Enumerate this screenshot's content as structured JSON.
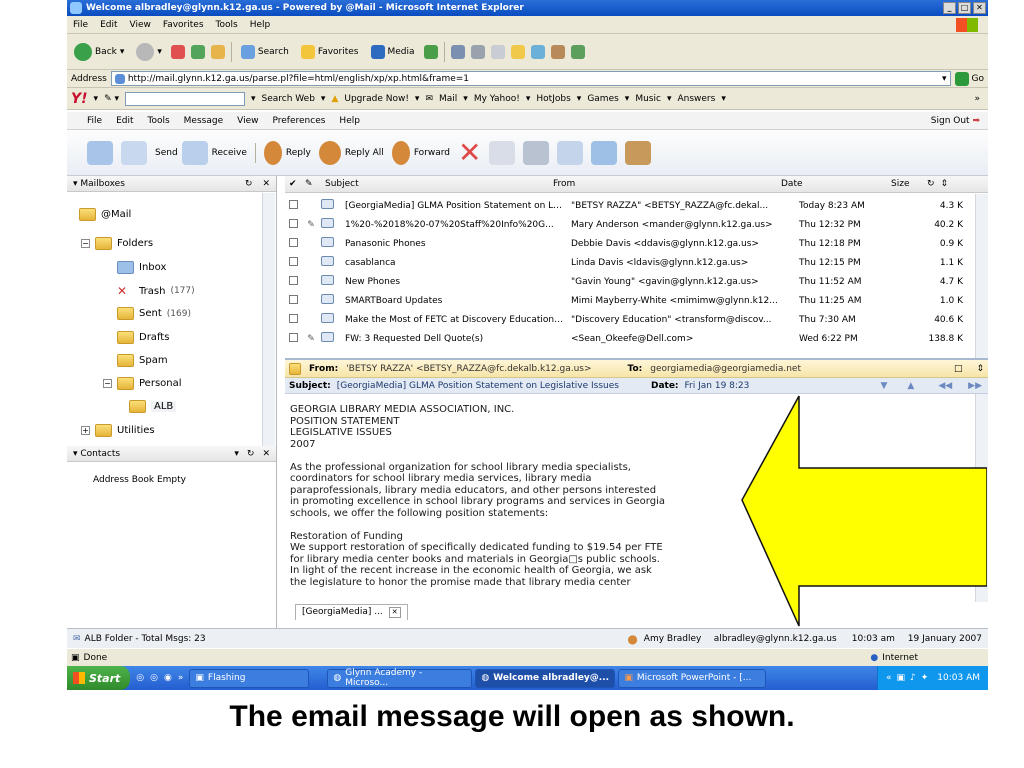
{
  "window": {
    "title": "Welcome albradley@glynn.k12.ga.us - Powered by @Mail - Microsoft Internet Explorer"
  },
  "ie_menu": [
    "File",
    "Edit",
    "View",
    "Favorites",
    "Tools",
    "Help"
  ],
  "ie_toolbar": {
    "back": "Back",
    "search": "Search",
    "favorites": "Favorites",
    "media": "Media"
  },
  "address": {
    "label": "Address",
    "url": "http://mail.glynn.k12.ga.us/parse.pl?file=html/english/xp/xp.html&frame=1",
    "go": "Go"
  },
  "yahoo_bar": {
    "search_web": "Search Web",
    "upgrade": "Upgrade Now!",
    "mail": "Mail",
    "my_yahoo": "My Yahoo!",
    "hotjobs": "HotJobs",
    "games": "Games",
    "music": "Music",
    "answers": "Answers"
  },
  "app_menu": [
    "File",
    "Edit",
    "Tools",
    "Message",
    "View",
    "Preferences",
    "Help"
  ],
  "sign_out": "Sign Out",
  "app_toolbar": {
    "send": "Send",
    "receive": "Receive",
    "reply": "Reply",
    "reply_all": "Reply All",
    "forward": "Forward"
  },
  "mailboxes": {
    "header": "Mailboxes",
    "root": "@Mail",
    "folders_label": "Folders",
    "inbox": "Inbox",
    "trash": "Trash",
    "trash_count": "(177)",
    "sent": "Sent",
    "sent_count": "(169)",
    "drafts": "Drafts",
    "spam": "Spam",
    "personal": "Personal",
    "alb": "ALB",
    "utilities": "Utilities"
  },
  "contacts": {
    "header": "Contacts",
    "empty": "Address Book Empty"
  },
  "message_list": {
    "columns": {
      "subject": "Subject",
      "from": "From",
      "date": "Date",
      "size": "Size"
    },
    "rows": [
      {
        "subject": "[GeorgiaMedia] GLMA Position Statement on Leg...",
        "from": "\"BETSY RAZZA\" <BETSY_RAZZA@fc.dekal...",
        "date": "Today 8:23 AM",
        "size": "4.3 K",
        "attach": ""
      },
      {
        "subject": "1%20-%2018%20-07%20Staff%20Info%20G...",
        "from": "Mary Anderson <mander@glynn.k12.ga.us>",
        "date": "Thu 12:32 PM",
        "size": "40.2 K",
        "attach": "✎"
      },
      {
        "subject": "Panasonic Phones",
        "from": "Debbie Davis <ddavis@glynn.k12.ga.us>",
        "date": "Thu 12:18 PM",
        "size": "0.9 K",
        "attach": ""
      },
      {
        "subject": "casablanca",
        "from": "Linda Davis <ldavis@glynn.k12.ga.us>",
        "date": "Thu 12:15 PM",
        "size": "1.1 K",
        "attach": ""
      },
      {
        "subject": "New Phones",
        "from": "\"Gavin Young\" <gavin@glynn.k12.ga.us>",
        "date": "Thu 11:52 AM",
        "size": "4.7 K",
        "attach": ""
      },
      {
        "subject": "SMARTBoard Updates",
        "from": "Mimi Mayberry-White <mimimw@glynn.k12...",
        "date": "Thu 11:25 AM",
        "size": "1.0 K",
        "attach": ""
      },
      {
        "subject": "Make the Most of FETC at Discovery Education ...",
        "from": "\"Discovery Education\" <transform@discov...",
        "date": "Thu 7:30 AM",
        "size": "40.6 K",
        "attach": ""
      },
      {
        "subject": "FW: 3 Requested Dell Quote(s)",
        "from": "<Sean_Okeefe@Dell.com>",
        "date": "Wed 6:22 PM",
        "size": "138.8 K",
        "attach": "✎"
      }
    ]
  },
  "preview": {
    "from_label": "From:",
    "from_value": "'BETSY RAZZA' <BETSY_RAZZA@fc.dekalb.k12.ga.us>",
    "to_label": "To:",
    "to_value": "georgiamedia@georgiamedia.net",
    "subject_label": "Subject:",
    "subject_value": "[GeorgiaMedia] GLMA Position Statement on Legislative Issues",
    "date_label": "Date:",
    "date_value": "Fri Jan 19 8:23",
    "body": "GEORGIA LIBRARY MEDIA ASSOCIATION, INC.\nPOSITION STATEMENT\nLEGISLATIVE ISSUES\n2007\n\nAs the professional organization for school library media specialists,\ncoordinators for school library media services, library media\nparaprofessionals, library media educators, and other persons interested\nin promoting excellence in school library programs and services in Georgia\nschools, we offer the following position statements:\n\nRestoration of Funding\nWe support restoration of specifically dedicated funding to $19.54 per FTE\nfor library media center books and materials in Georgia□s public schools.\nIn light of the recent increase in the economic health of Georgia, we ask\nthe legislature to honor the promise made that library media center",
    "tab": "[GeorgiaMedia] ..."
  },
  "status": {
    "folder": "ALB Folder - Total Msgs: 23",
    "user": "Amy Bradley",
    "email": "albradley@glynn.k12.ga.us",
    "time": "10:03 am",
    "date": "19 January 2007"
  },
  "ie_status": {
    "done": "Done",
    "zone": "Internet"
  },
  "taskbar": {
    "start": "Start",
    "flashing": "Flashing",
    "task1": "Glynn Academy - Microso...",
    "task2": "Welcome albradley@...",
    "task3": "Microsoft PowerPoint - [...",
    "clock": "10:03 AM"
  },
  "caption": "The email message will open as shown.",
  "colors": {
    "arrow_fill": "#ffff00",
    "title_blue": "#0a4cc0"
  }
}
